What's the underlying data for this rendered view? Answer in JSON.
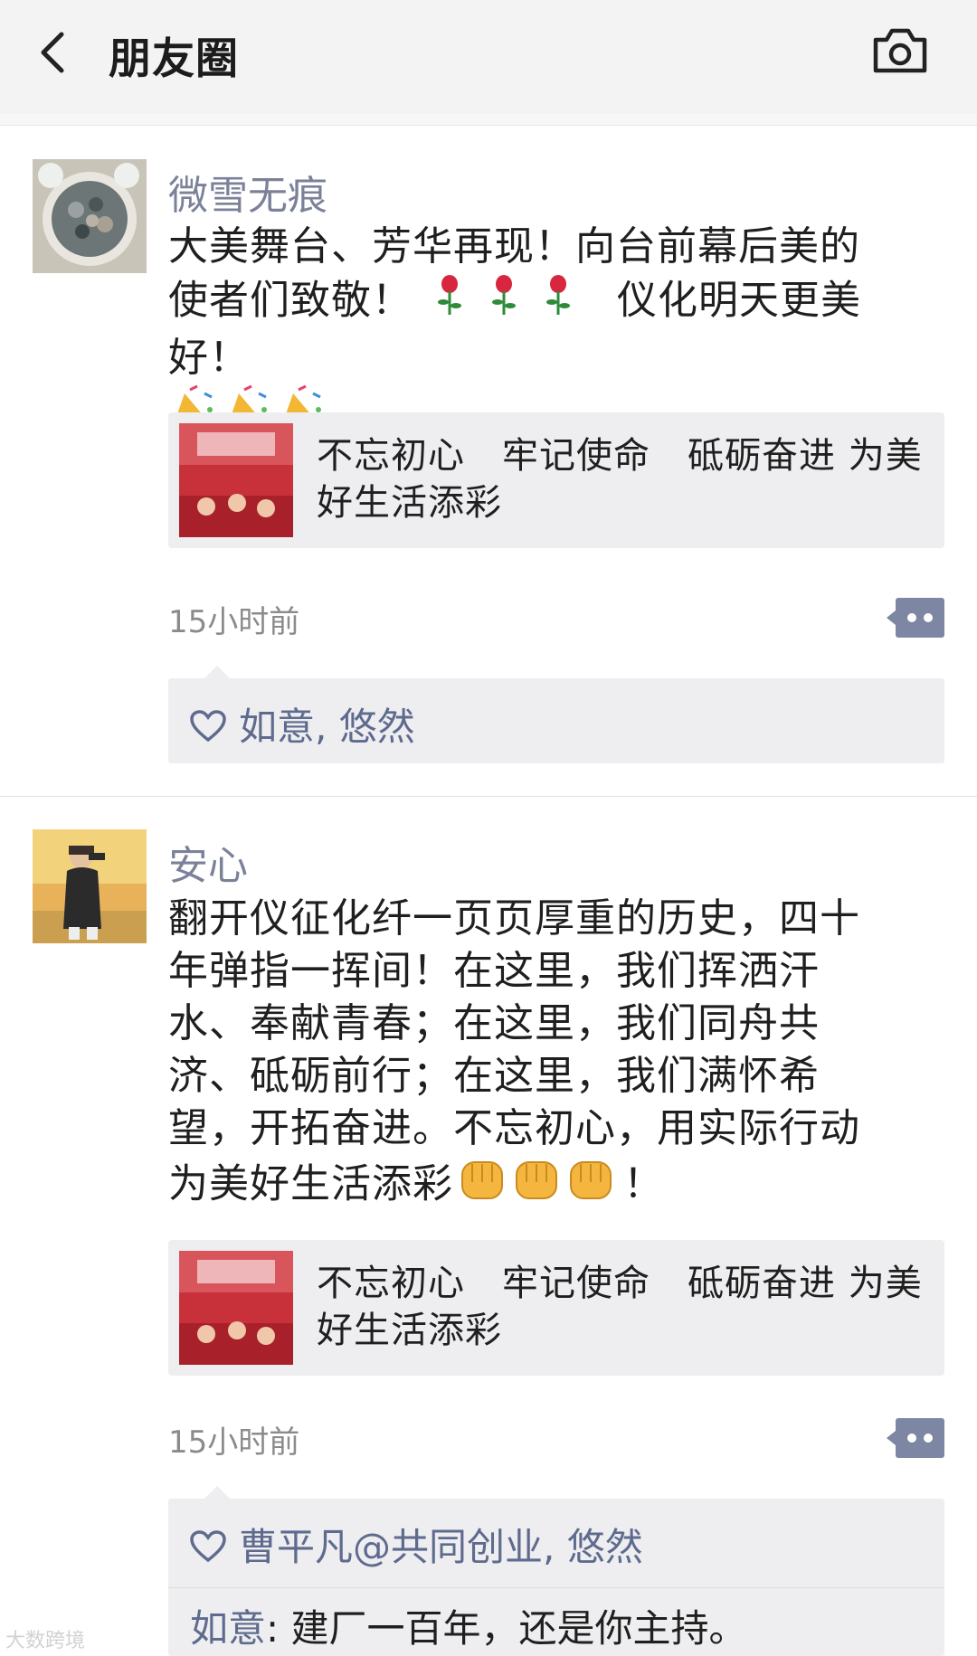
{
  "header": {
    "title": "朋友圈",
    "back_icon": "chevron-left-icon",
    "camera_icon": "camera-icon"
  },
  "posts": [
    {
      "name": "微雪无痕",
      "text_line1": "大美舞台、芳华再现！向台前幕后美的",
      "text_line2a": "使者们致敬！",
      "text_line2b": "仪化明天更美好！",
      "emojis_a": "rose-emoji ×3",
      "emojis_b": "party-popper-emoji ×3",
      "link_title": "不忘初心　牢记使命　砥砺奋进  为美好生活添彩",
      "time": "15小时前",
      "likes": "如意, 悠然"
    },
    {
      "name": "安心",
      "text_lines": [
        "翻开仪征化纤一页页厚重的历史，四十",
        "年弹指一挥间！在这里，我们挥洒汗",
        "水、奉献青春；在这里，我们同舟共",
        "济、砥砺前行；在这里，我们满怀希",
        "望，开拓奋进。不忘初心，用实际行动"
      ],
      "text_last": "为美好生活添彩",
      "text_end": "！",
      "emojis": "fist-emoji ×3",
      "link_title": "不忘初心　牢记使命　砥砺奋进  为美好生活添彩",
      "time": "15小时前",
      "likes": "曹平凡@共同创业, 悠然",
      "comment_author": "如意",
      "comment_sep": ": ",
      "comment_text": "建厂一百年，还是你主持。"
    }
  ],
  "watermark": "大数跨境",
  "colors": {
    "name_blue": "#7b8199",
    "link_blue": "#5f6b8e",
    "header_bg": "#f3f3f3",
    "card_bg": "#eeeef0"
  }
}
